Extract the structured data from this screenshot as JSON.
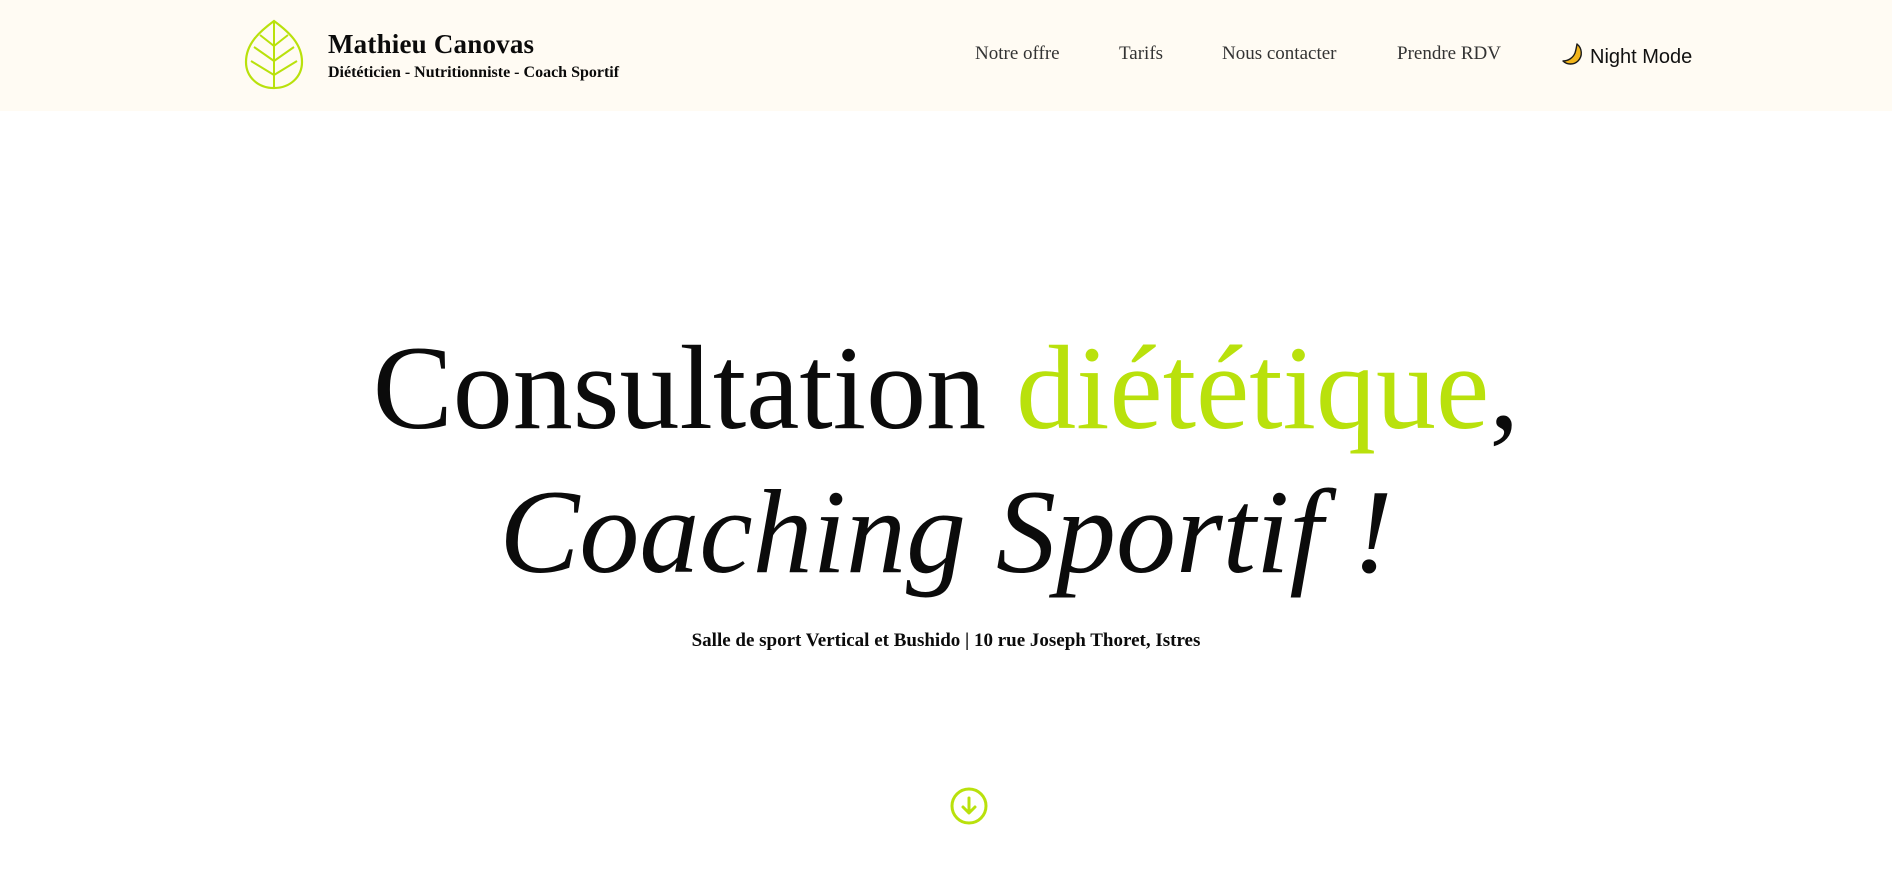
{
  "header": {
    "brand_name": "Mathieu Canovas",
    "brand_tagline": "Diététicien - Nutritionniste - Coach Sportif",
    "logo_icon": "leaf-icon",
    "nav": [
      {
        "label": "Notre offre"
      },
      {
        "label": "Tarifs"
      },
      {
        "label": "Nous contacter"
      },
      {
        "label": "Prendre RDV"
      }
    ],
    "night_mode": {
      "label": "Night Mode",
      "icon": "moon-icon"
    }
  },
  "hero": {
    "title_part1": "Consultation ",
    "title_accent": "diététique",
    "title_comma": ",",
    "title_line2": "Coaching Sportif !",
    "address": "Salle de sport Vertical et Bushido | 10 rue Joseph Thoret, Istres",
    "scroll_icon": "arrow-down-circle-icon"
  },
  "colors": {
    "accent": "#b9e10c",
    "header_bg": "#fffbf3",
    "text": "#0b0b0b",
    "moon": "#f2b51b"
  }
}
